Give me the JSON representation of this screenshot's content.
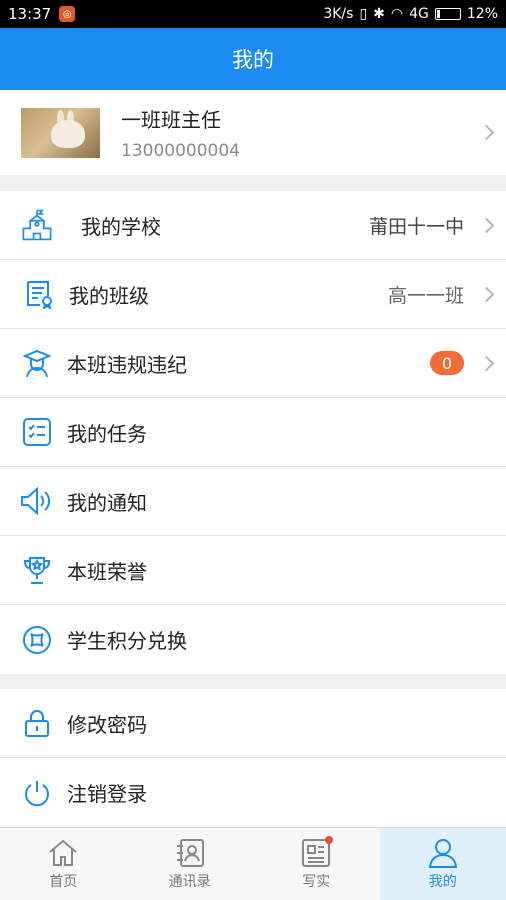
{
  "status_bar": {
    "time": "13:37",
    "network_speed": "3K/s",
    "network_type": "4G",
    "battery": "12%"
  },
  "header": {
    "title": "我的"
  },
  "profile": {
    "name": "一班班主任",
    "phone": "13000000004"
  },
  "menu_primary": [
    {
      "label": "我的学校",
      "value": "莆田十一中",
      "icon": "school-icon"
    },
    {
      "label": "我的班级",
      "value": "高一一班",
      "icon": "certificate-icon"
    },
    {
      "label": "本班违规违纪",
      "badge": "0",
      "icon": "graduate-icon"
    },
    {
      "label": "我的任务",
      "icon": "task-list-icon"
    },
    {
      "label": "我的通知",
      "icon": "speaker-icon"
    },
    {
      "label": "本班荣誉",
      "icon": "trophy-icon"
    },
    {
      "label": "学生积分兑换",
      "icon": "exchange-icon"
    }
  ],
  "menu_secondary": [
    {
      "label": "修改密码",
      "icon": "lock-icon"
    },
    {
      "label": "注销登录",
      "icon": "power-icon"
    }
  ],
  "tabs": [
    {
      "label": "首页",
      "icon": "home-icon"
    },
    {
      "label": "通讯录",
      "icon": "contacts-icon"
    },
    {
      "label": "写实",
      "icon": "record-icon",
      "has_dot": true
    },
    {
      "label": "我的",
      "icon": "user-icon",
      "active": true
    }
  ],
  "colors": {
    "primary": "#1d8cf0",
    "badge": "#f26b3a",
    "icon": "#1d8cf0"
  }
}
